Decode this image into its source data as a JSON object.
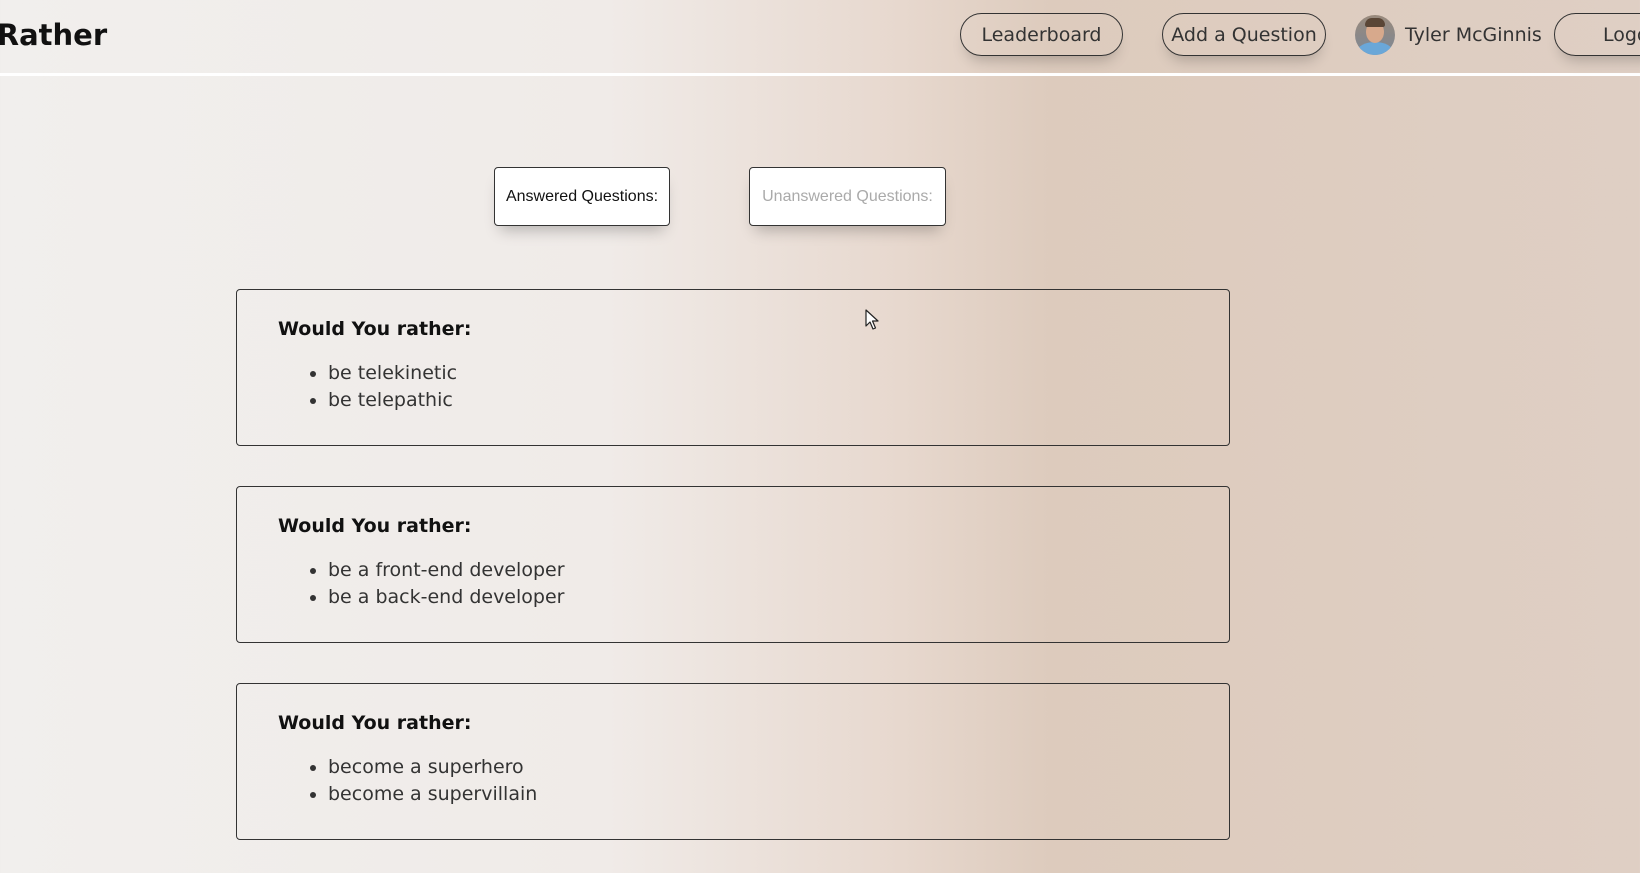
{
  "header": {
    "title": "u Rather",
    "nav": {
      "leaderboard_label": "Leaderboard",
      "add_question_label": "Add a Question",
      "logout_label": "Logo"
    },
    "user": {
      "name": "Tyler McGinnis",
      "avatar_icon": "user-avatar"
    }
  },
  "tabs": [
    {
      "label": "Answered Questions:",
      "active": true
    },
    {
      "label": "Unanswered Questions:",
      "active": false
    }
  ],
  "questions": [
    {
      "heading": "Would You rather:",
      "options": [
        "be telekinetic",
        "be telepathic"
      ]
    },
    {
      "heading": "Would You rather:",
      "options": [
        "be a front-end developer",
        "be a back-end developer"
      ]
    },
    {
      "heading": "Would You rather:",
      "options": [
        "become a superhero",
        "become a supervillain"
      ]
    }
  ],
  "colors": {
    "border": "#333333",
    "inactive_tab_text": "#aaaaaa",
    "background_light": "#f1efed",
    "background_tan": "#ddcbbd"
  }
}
